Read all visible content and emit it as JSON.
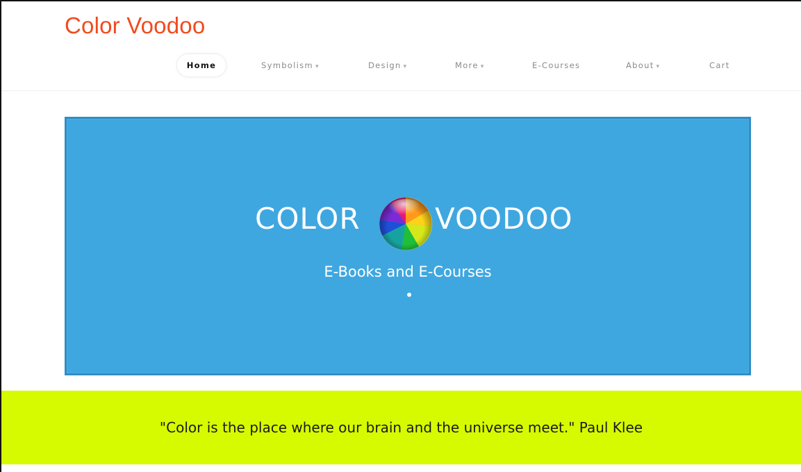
{
  "site": {
    "title": "Color Voodoo",
    "title_color": "#f24a1e"
  },
  "nav": {
    "items": [
      {
        "label": "Home",
        "has_dropdown": false,
        "active": true
      },
      {
        "label": "Symbolism",
        "has_dropdown": true,
        "active": false
      },
      {
        "label": "Design",
        "has_dropdown": true,
        "active": false
      },
      {
        "label": "More",
        "has_dropdown": true,
        "active": false
      },
      {
        "label": "E-Courses",
        "has_dropdown": false,
        "active": false
      },
      {
        "label": "About",
        "has_dropdown": true,
        "active": false
      },
      {
        "label": "Cart",
        "has_dropdown": false,
        "active": false
      }
    ],
    "dropdown_glyph": "▾"
  },
  "hero": {
    "logo_left": "COLOR",
    "logo_right": "VOODOO",
    "logo_icon": "color-wheel-orb-icon",
    "subtitle": "E-Books and E-Courses",
    "background_color": "#3fa7e0",
    "border_color": "#2f8ec7"
  },
  "quote": {
    "text": "\"Color is the place where our brain and the universe meet.\" Paul Klee",
    "background_color": "#d6fb00"
  }
}
